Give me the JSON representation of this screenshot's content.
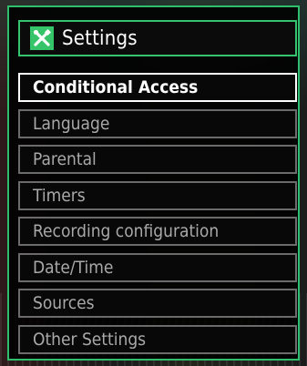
{
  "header": {
    "title": "Settings",
    "icon": "tools-icon",
    "accent_color": "#35c46a"
  },
  "menu": {
    "selected_index": 0,
    "items": [
      {
        "label": "Conditional Access"
      },
      {
        "label": "Language"
      },
      {
        "label": "Parental"
      },
      {
        "label": "Timers"
      },
      {
        "label": "Recording configuration"
      },
      {
        "label": "Date/Time"
      },
      {
        "label": "Sources"
      },
      {
        "label": "Other Settings"
      }
    ]
  }
}
